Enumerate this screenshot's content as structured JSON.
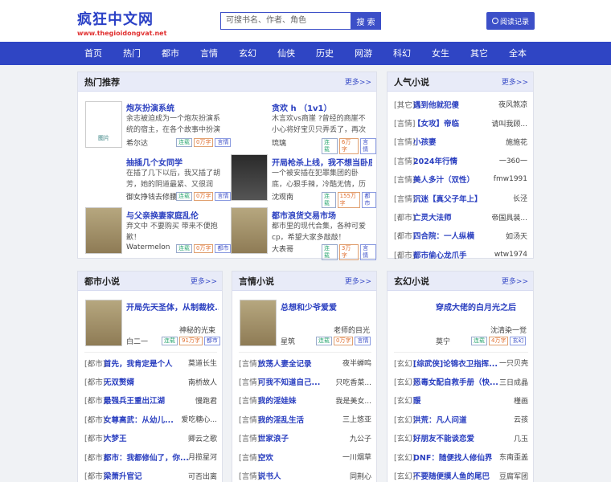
{
  "header": {
    "logo_name": "疯狂中文网",
    "logo_url": "www.thegioidongvat.net",
    "search_placeholder": "可搜书名、作者、角色",
    "search_button": "搜 索",
    "history_button": "阅读记录"
  },
  "nav": [
    "首页",
    "热门",
    "都市",
    "言情",
    "玄幻",
    "仙侠",
    "历史",
    "网游",
    "科幻",
    "女生",
    "其它",
    "全本"
  ],
  "hot": {
    "title": "热门推荐",
    "more": "更多>>",
    "books": [
      {
        "title": "炮灰扮演系统",
        "desc": "余志被迫成为一个炮灰扮演系统的宿主，在各个故事中扮演炮灰",
        "author": "希尔达",
        "tags": [
          "连载",
          "0万字",
          "言情"
        ]
      },
      {
        "title": "贪欢 h （1v1）",
        "desc": "木言欢vs商崖 ?曾经的商崖不小心将好宝贝只弄丢了，再次重逢，",
        "author": "琉璃",
        "tags": [
          "连载",
          "6万字",
          "言情"
        ]
      },
      {
        "title": "抽插几个女同学",
        "desc": "在插了几下以后，我又插了胡芳，她的阴道最紧、又很润滑，",
        "author": "御女挣钱去修腰",
        "tags": [
          "连载",
          "0万字",
          "言情"
        ]
      },
      {
        "title": "开局枪杀上线，我不想当卧底",
        "desc": "一个被安插在犯罪集团的卧底，心狠手辣，冷酷无情，历尽波折",
        "author": "沈观南",
        "tags": [
          "连载",
          "155万字",
          "都市"
        ]
      },
      {
        "title": "与父亲换妻家庭乱伦",
        "desc": "弃文中 不要购买 带来不便抱歉！",
        "author": "Watermelon",
        "tags": [
          "连载",
          "0万字",
          "都市"
        ]
      },
      {
        "title": "都市浪货交易市场",
        "desc": "都市里的现代合集，各种可爱cp，希望大家多敲敲！",
        "author": "大表哥",
        "tags": [
          "连载",
          "3万字",
          "言情"
        ]
      }
    ]
  },
  "popular": {
    "title": "人气小说",
    "more": "更多>>",
    "rows": [
      {
        "cat": "[其它]",
        "title": "遇到他就犯傻",
        "author": "夜风煞凉"
      },
      {
        "cat": "[言情]",
        "title": "【女攻】帝临",
        "author": "请叫我顾..."
      },
      {
        "cat": "[言情]",
        "title": "小孩妻",
        "author": "施施花"
      },
      {
        "cat": "[言情]",
        "title": "2024年行情",
        "author": "一360一"
      },
      {
        "cat": "[言情]",
        "title": "美人多汁（双性）",
        "author": "fmw1991"
      },
      {
        "cat": "[言情]",
        "title": "沉迷【真父子年上】",
        "author": "长泾"
      },
      {
        "cat": "[都市]",
        "title": "亡灵大法师",
        "author": "帝国具装..."
      },
      {
        "cat": "[都市]",
        "title": "四合院：一人纵横",
        "author": "如汤天"
      },
      {
        "cat": "[都市]",
        "title": "都市偷心龙爪手",
        "author": "wtw1974"
      }
    ]
  },
  "urban": {
    "title": "都市小说",
    "more": "更多>>",
    "feature": {
      "title": "开局先天圣体，从制裁校...",
      "author": "神秘的光束",
      "sub": "白二一",
      "tags": [
        "连载",
        "91万字",
        "都市"
      ]
    },
    "rows": [
      {
        "cat": "[都市]",
        "title": "首先，我肯定是个人",
        "author": "莫道长生"
      },
      {
        "cat": "[都市]",
        "title": "无双赘婿",
        "author": "南桥故人"
      },
      {
        "cat": "[都市]",
        "title": "最强兵王重出江湖",
        "author": "慢跑君"
      },
      {
        "cat": "[都市]",
        "title": "女尊高武：从幼儿...",
        "author": "爱吃糖心..."
      },
      {
        "cat": "[都市]",
        "title": "大梦王",
        "author": "卿云之歌"
      },
      {
        "cat": "[都市]",
        "title": "都市：我都修仙了，你...",
        "author": "月揽星河"
      },
      {
        "cat": "[都市]",
        "title": "梁萧升官记",
        "author": "可否出离"
      }
    ]
  },
  "romance": {
    "title": "言情小说",
    "more": "更多>>",
    "feature": {
      "title": "总想和少爷爱爱",
      "author": "老师的目光",
      "sub": "星筑",
      "tags": [
        "连载",
        "0万字",
        "言情"
      ]
    },
    "rows": [
      {
        "cat": "[言情]",
        "title": "放荡人妻全记录",
        "author": "夜半蝉鸣"
      },
      {
        "cat": "[言情]",
        "title": "可我不知道自己...",
        "author": "只吃香菜..."
      },
      {
        "cat": "[言情]",
        "title": "我的淫娃妹",
        "author": "我是美女..."
      },
      {
        "cat": "[言情]",
        "title": "我的淫乱生活",
        "author": "三上悠亚"
      },
      {
        "cat": "[言情]",
        "title": "世家浪子",
        "author": "九公子"
      },
      {
        "cat": "[言情]",
        "title": "空欢",
        "author": "一川烟草"
      },
      {
        "cat": "[言情]",
        "title": "说书人",
        "author": "同荆心"
      }
    ]
  },
  "fantasy": {
    "title": "玄幻小说",
    "more": "更多>>",
    "feature": {
      "title": "穿成大佬的白月光之后",
      "author": "沈清染一觉",
      "sub": "莫宁",
      "tags": [
        "连载",
        "4万字",
        "玄幻"
      ]
    },
    "rows": [
      {
        "cat": "[玄幻]",
        "title": "[综武侠]论锦衣卫指挥...",
        "author": "一只贝壳"
      },
      {
        "cat": "[玄幻]",
        "title": "恶毒女配自救手册（快...",
        "author": "三日成晶"
      },
      {
        "cat": "[玄幻]",
        "title": "暖",
        "author": "槿画"
      },
      {
        "cat": "[玄幻]",
        "title": "洪荒：凡人问道",
        "author": "云孩"
      },
      {
        "cat": "[玄幻]",
        "title": "好朋友不能谈恋爱",
        "author": "几玉"
      },
      {
        "cat": "[玄幻]",
        "title": "DNF：随便找人修仙界",
        "author": "东南歪盖"
      },
      {
        "cat": "[玄幻]",
        "title": "不要随便摸人鱼的尾巴",
        "author": "豆腐军团"
      }
    ]
  }
}
